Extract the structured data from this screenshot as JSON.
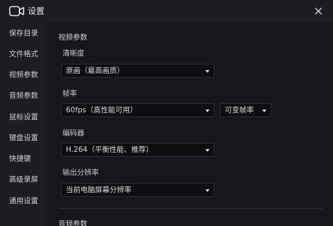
{
  "window": {
    "title": "设置",
    "app_icon": "camera-icon",
    "close_icon": "close-icon"
  },
  "sidebar": {
    "items": [
      {
        "label": "保存目录"
      },
      {
        "label": "文件格式"
      },
      {
        "label": "视频参数"
      },
      {
        "label": "音频参数"
      },
      {
        "label": "鼠标设置"
      },
      {
        "label": "键盘设置"
      },
      {
        "label": "快捷键"
      },
      {
        "label": "高级录屏"
      },
      {
        "label": "通用设置"
      }
    ]
  },
  "main": {
    "video_section_title": "视频参数",
    "clarity": {
      "label": "清晰度",
      "value": "原画（最高画质）"
    },
    "framerate": {
      "label": "帧率",
      "value": "60fps（高性能可用）",
      "mode_value": "可变帧率"
    },
    "encoder": {
      "label": "编码器",
      "value": "H.264（平衡性能、推荐）"
    },
    "resolution": {
      "label": "输出分辨率",
      "value": "当前电脑屏幕分辨率"
    },
    "audio_section_title": "音频参数"
  },
  "colors": {
    "sidebar_bg": "#1c1d21",
    "content_bg": "#16171a",
    "select_bg": "#0d0e10",
    "text": "#d6d6d6"
  }
}
